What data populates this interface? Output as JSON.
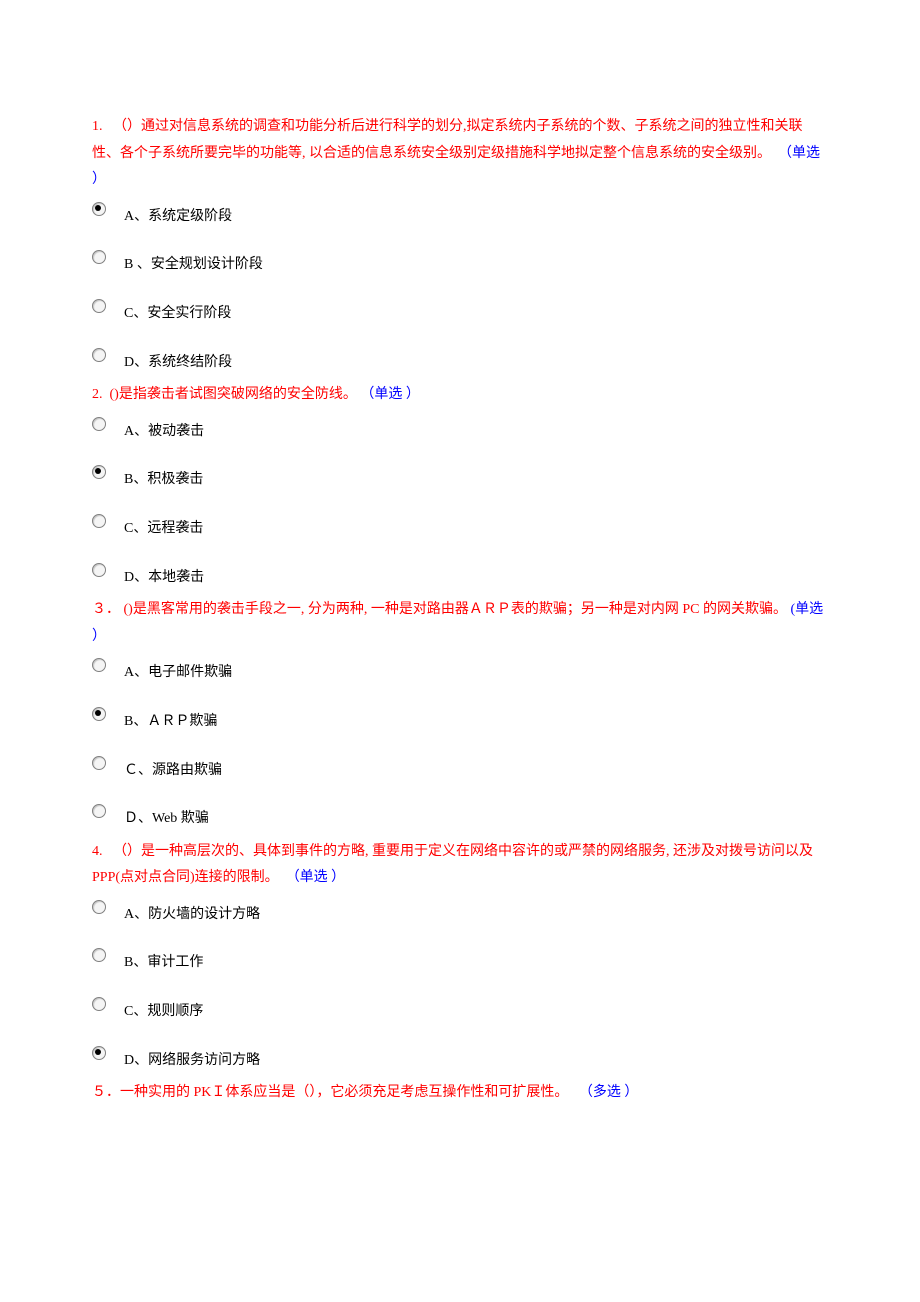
{
  "questions": [
    {
      "num": "1.",
      "text": "（）通过对信息系统的调查和功能分析后进行科学的划分,拟定系统内子系统的个数、子系统之间的独立性和关联性、各个子系统所要完毕的功能等, 以合适的信息系统安全级别定级措施科学地拟定整个信息系统的安全级别。",
      "type": "（单选  ）",
      "options": [
        {
          "label": "A、系统定级阶段",
          "selected": true
        },
        {
          "label": "B 、安全规划设计阶段",
          "selected": false
        },
        {
          "label": "C、安全实行阶段",
          "selected": false
        },
        {
          "label": "D、系统终结阶段",
          "selected": false
        }
      ]
    },
    {
      "num": "2.",
      "text": "()是指袭击者试图突破网络的安全防线。",
      "type": "（单选  ）",
      "options": [
        {
          "label": "A、被动袭击",
          "selected": false
        },
        {
          "label": "B、积极袭击",
          "selected": true
        },
        {
          "label": "C、远程袭击",
          "selected": false
        },
        {
          "label": "D、本地袭击",
          "selected": false
        }
      ]
    },
    {
      "num": "３．",
      "text": "()是黑客常用的袭击手段之一, 分为两种, 一种是对路由器ＡＲＰ表的欺骗；另一种是对内网 PC 的网关欺骗。",
      "type": "(单选 ）",
      "options": [
        {
          "label": "A、电子邮件欺骗",
          "selected": false
        },
        {
          "label": "B、ＡＲＰ欺骗",
          "selected": true
        },
        {
          "label": "Ｃ、源路由欺骗",
          "selected": false
        },
        {
          "label": "Ｄ、Web 欺骗",
          "selected": false
        }
      ]
    },
    {
      "num": "4.",
      "text": "（）是一种高层次的、具体到事件的方略, 重要用于定义在网络中容许的或严禁的网络服务, 还涉及对拨号访问以及 PPP(点对点合同)连接的限制。",
      "type": "（单选 ）",
      "options": [
        {
          "label": "A、防火墙的设计方略",
          "selected": false
        },
        {
          "label": "B、审计工作",
          "selected": false
        },
        {
          "label": "C、规则顺序",
          "selected": false
        },
        {
          "label": "D、网络服务访问方略",
          "selected": true
        }
      ]
    },
    {
      "num": "５．",
      "text": "一种实用的 PKＩ体系应当是（），它必须充足考虑互操作性和可扩展性。",
      "type": "（多选 ）",
      "options": []
    }
  ]
}
